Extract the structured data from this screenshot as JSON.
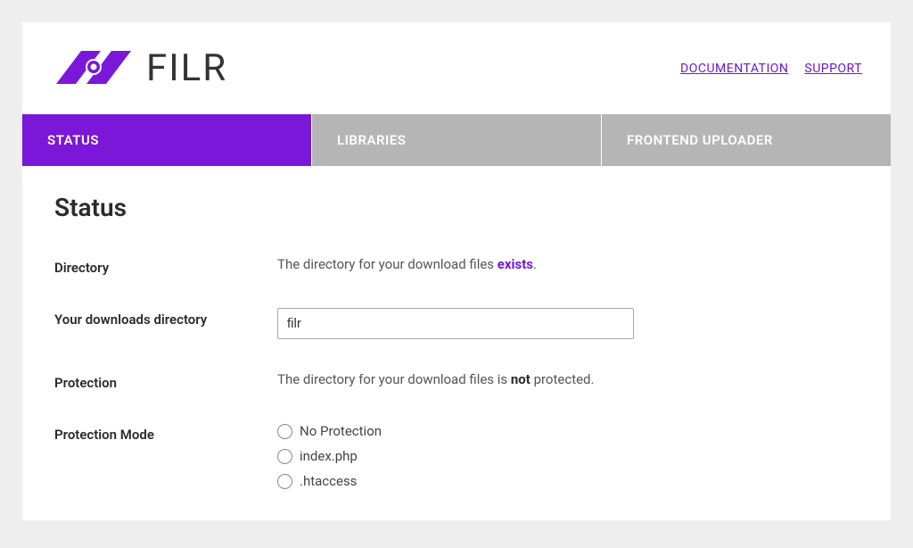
{
  "brand": {
    "name": "FILR"
  },
  "header_links": {
    "documentation": "DOCUMENTATION",
    "support": "SUPPORT"
  },
  "tabs": {
    "status": "STATUS",
    "libraries": "LIBRARIES",
    "frontend_uploader": "FRONTEND UPLOADER"
  },
  "page": {
    "title": "Status"
  },
  "status": {
    "directory": {
      "label": "Directory",
      "text_before": "The directory for your download files ",
      "highlight": "exists",
      "text_after": "."
    },
    "downloads_dir": {
      "label": "Your downloads directory",
      "value": "filr"
    },
    "protection": {
      "label": "Protection",
      "text_before": "The directory for your download files is ",
      "highlight": "not",
      "text_after": " protected."
    },
    "protection_mode": {
      "label": "Protection Mode",
      "options": {
        "no_protection": "No Protection",
        "index_php": "index.php",
        "htaccess": ".htaccess"
      }
    }
  }
}
